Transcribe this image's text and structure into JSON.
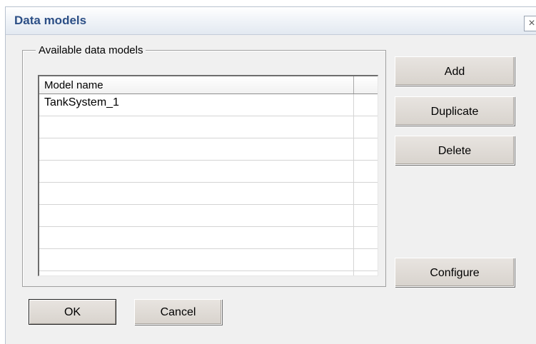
{
  "dialog": {
    "title": "Data models",
    "close_glyph": "×"
  },
  "group": {
    "label": "Available data models"
  },
  "grid": {
    "columns": [
      "Model name",
      ""
    ],
    "rows": [
      [
        "TankSystem_1",
        ""
      ],
      [
        "",
        ""
      ],
      [
        "",
        ""
      ],
      [
        "",
        ""
      ],
      [
        "",
        ""
      ],
      [
        "",
        ""
      ],
      [
        "",
        ""
      ],
      [
        "",
        ""
      ],
      [
        "",
        ""
      ]
    ]
  },
  "buttons": {
    "add": "Add",
    "duplicate": "Duplicate",
    "delete": "Delete",
    "configure": "Configure",
    "ok": "OK",
    "cancel": "Cancel"
  },
  "colors": {
    "title_text": "#2c4f86",
    "dialog_bg": "#f0f0f0",
    "button_face": "#dcd7d1"
  }
}
